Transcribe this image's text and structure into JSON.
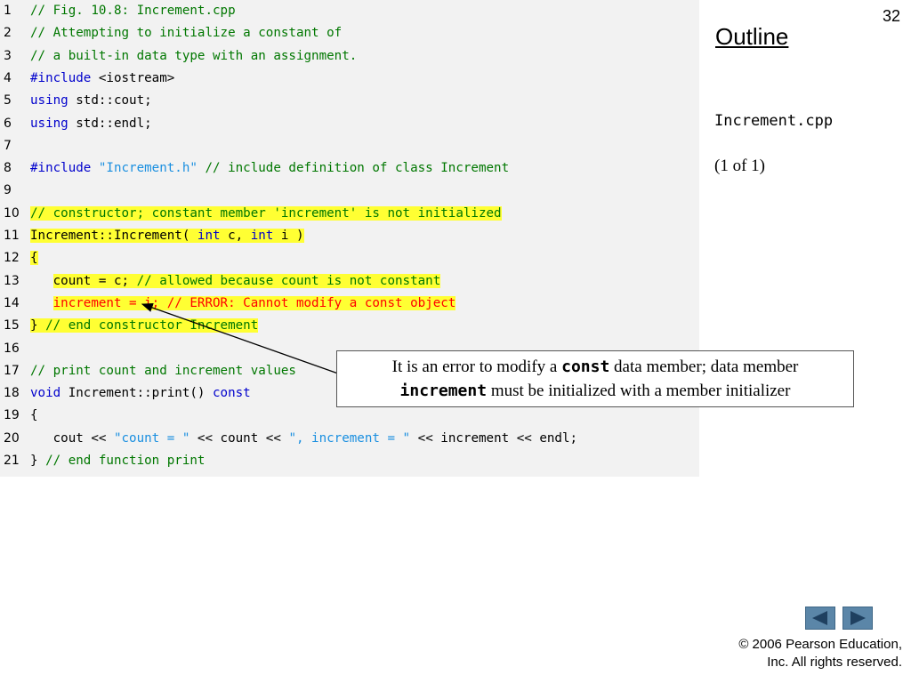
{
  "slide_number": "32",
  "sidebar": {
    "outline_label": "Outline",
    "file_title": "Increment.cpp",
    "page_info": "(1 of 1)"
  },
  "code": {
    "lines": [
      {
        "num": "1",
        "segs": [
          {
            "t": "// Fig. 10.8: Increment.cpp",
            "c": "c"
          }
        ]
      },
      {
        "num": "2",
        "segs": [
          {
            "t": "// Attempting to initialize a constant of",
            "c": "c"
          }
        ]
      },
      {
        "num": "3",
        "segs": [
          {
            "t": "// a built-in data type with an assignment.",
            "c": "c"
          }
        ]
      },
      {
        "num": "4",
        "segs": [
          {
            "t": "#include",
            "c": "k"
          },
          {
            "t": " <iostream>",
            "c": "n"
          }
        ]
      },
      {
        "num": "5",
        "segs": [
          {
            "t": "using",
            "c": "k"
          },
          {
            "t": " std::cout;",
            "c": "n"
          }
        ]
      },
      {
        "num": "6",
        "segs": [
          {
            "t": "using",
            "c": "k"
          },
          {
            "t": " std::endl;",
            "c": "n"
          }
        ]
      },
      {
        "num": "7",
        "segs": []
      },
      {
        "num": "8",
        "segs": [
          {
            "t": "#include",
            "c": "k"
          },
          {
            "t": " ",
            "c": "n"
          },
          {
            "t": "\"Increment.h\"",
            "c": "s"
          },
          {
            "t": " // include definition of class Increment",
            "c": "c"
          }
        ]
      },
      {
        "num": "9",
        "segs": []
      },
      {
        "num": "10",
        "segs": [
          {
            "t": "// constructor; constant member 'increment' is not initialized",
            "c": "c hl"
          }
        ]
      },
      {
        "num": "11",
        "segs": [
          {
            "t": "Increment::Increment( ",
            "c": "n hl"
          },
          {
            "t": "int",
            "c": "k hl"
          },
          {
            "t": " c, ",
            "c": "n hl"
          },
          {
            "t": "int",
            "c": "k hl"
          },
          {
            "t": " i )",
            "c": "n hl"
          }
        ]
      },
      {
        "num": "12",
        "segs": [
          {
            "t": "{",
            "c": "n hl"
          }
        ]
      },
      {
        "num": "13",
        "segs": [
          {
            "t": "   ",
            "c": "n"
          },
          {
            "t": "count = c; ",
            "c": "n hl"
          },
          {
            "t": "// allowed because count is not constant",
            "c": "c hl"
          }
        ]
      },
      {
        "num": "14",
        "segs": [
          {
            "t": "   ",
            "c": "n"
          },
          {
            "t": "increment = i; // ERROR: Cannot modify a const object",
            "c": "e hl"
          }
        ]
      },
      {
        "num": "15",
        "segs": [
          {
            "t": "}",
            "c": "n hl"
          },
          {
            "t": " // end constructor Increment",
            "c": "c hl"
          }
        ]
      },
      {
        "num": "16",
        "segs": []
      },
      {
        "num": "17",
        "segs": [
          {
            "t": "// print count and increment values",
            "c": "c"
          }
        ]
      },
      {
        "num": "18",
        "segs": [
          {
            "t": "void",
            "c": "k"
          },
          {
            "t": " Increment::print() ",
            "c": "n"
          },
          {
            "t": "const",
            "c": "k"
          }
        ]
      },
      {
        "num": "19",
        "segs": [
          {
            "t": "{",
            "c": "n"
          }
        ]
      },
      {
        "num": "20",
        "segs": [
          {
            "t": "   cout << ",
            "c": "n"
          },
          {
            "t": "\"count = \"",
            "c": "s"
          },
          {
            "t": " << count << ",
            "c": "n"
          },
          {
            "t": "\", increment = \"",
            "c": "s"
          },
          {
            "t": " << increment << endl;",
            "c": "n"
          }
        ]
      },
      {
        "num": "21",
        "segs": [
          {
            "t": "}",
            "c": "n"
          },
          {
            "t": " // end function print",
            "c": "c"
          }
        ]
      }
    ]
  },
  "callout": {
    "text_1": "It is an error to modify a ",
    "code_1": "const",
    "text_2": " data member; data member",
    "code_2": "increment",
    "text_3": " must be initialized with a member initializer"
  },
  "nav": {
    "prev_icon": "triangle-left-icon",
    "next_icon": "triangle-right-icon"
  },
  "footer": {
    "copyright_line1": "© 2006 Pearson Education,",
    "copyright_line2": "Inc.  All rights reserved."
  },
  "colors": {
    "comment": "#007700",
    "keyword": "#0000cc",
    "string": "#1a8fe0",
    "error": "#ff0000",
    "highlight": "#ffff33",
    "nav_button": "#5b86a8"
  }
}
